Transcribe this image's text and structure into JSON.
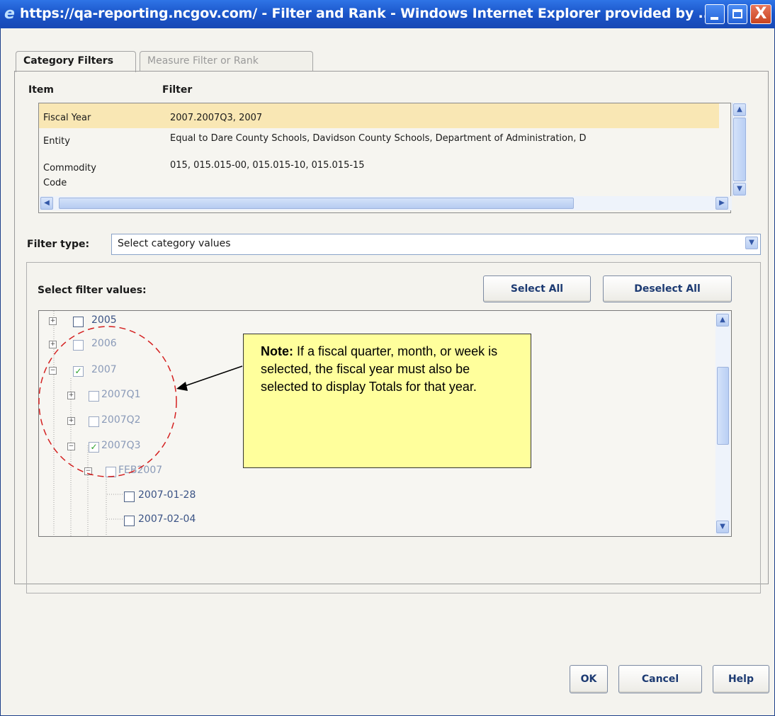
{
  "window": {
    "title": "https://qa-reporting.ncgov.com/ - Filter and Rank - Windows Internet Explorer provided by ...",
    "controls": {
      "minimize": "minimize",
      "maximize": "maximize",
      "close": "X"
    }
  },
  "tabs": [
    {
      "label": "Category Filters",
      "active": true
    },
    {
      "label": "Measure Filter or Rank",
      "active": false
    }
  ],
  "filters_table": {
    "headers": {
      "item": "Item",
      "filter": "Filter"
    },
    "rows": [
      {
        "item": "Fiscal Year",
        "filter": "2007.2007Q3, 2007",
        "selected": true
      },
      {
        "item": "Entity",
        "filter": "Equal to Dare County Schools, Davidson County Schools, Department of Administration, D"
      },
      {
        "item": "Commodity",
        "filter": "015, 015.015-00, 015.015-10, 015.015-15"
      },
      {
        "item": "Code",
        "filter": ""
      }
    ]
  },
  "filter_type": {
    "label": "Filter type:",
    "value": "Select category values"
  },
  "filter_values": {
    "label": "Select filter values:",
    "select_all": "Select All",
    "deselect_all": "Deselect All",
    "tree": [
      {
        "label": "2005",
        "checked": false
      },
      {
        "label": "2006",
        "checked": false
      },
      {
        "label": "2007",
        "checked": true
      },
      {
        "label": "2007Q1",
        "checked": false
      },
      {
        "label": "2007Q2",
        "checked": false
      },
      {
        "label": "2007Q3",
        "checked": true
      },
      {
        "label": "FEB2007",
        "checked": false
      },
      {
        "label": "2007-01-28",
        "checked": false
      },
      {
        "label": "2007-02-04",
        "checked": false
      }
    ]
  },
  "note": {
    "heading": "Note:",
    "text": " If a fiscal quarter, month, or week is selected, the fiscal year must also be selected to display Totals for that year."
  },
  "footer": {
    "ok": "OK",
    "cancel": "Cancel",
    "help": "Help"
  },
  "colors": {
    "titlebar": "#1b55c9",
    "selected_row": "#f9e7b4",
    "note_bg": "#ffff9c",
    "highlight_circle": "#d42020"
  }
}
